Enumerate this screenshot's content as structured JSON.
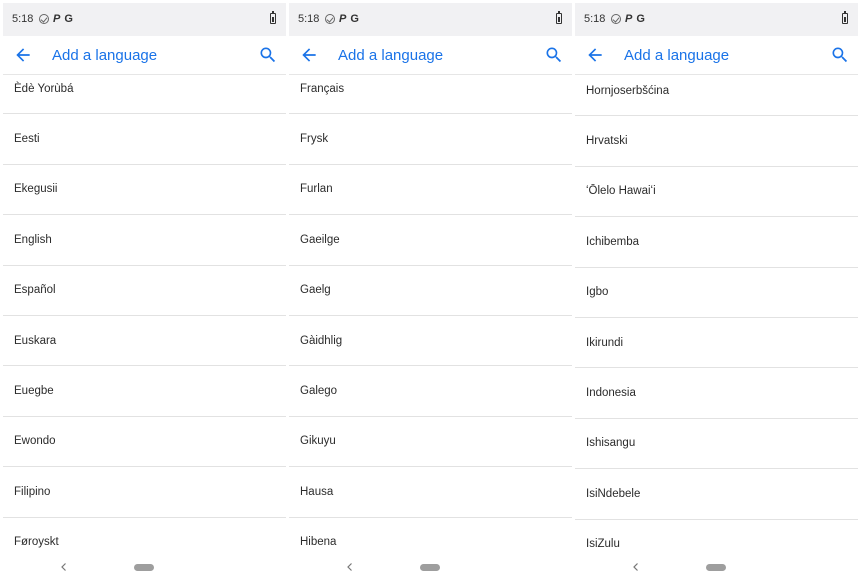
{
  "status_bar": {
    "time": "5:18",
    "p_glyph": "P",
    "g_glyph": "G"
  },
  "app_bar": {
    "title": "Add a language",
    "back_icon": "arrow-back-icon",
    "search_icon": "search-icon"
  },
  "colors": {
    "accent": "#1a73e8",
    "status_bar_bg": "#f1f1f3",
    "divider": "#e2e2e2"
  },
  "panels": [
    {
      "items": [
        "Èdè Yorùbá",
        "Eesti",
        "Ekegusii",
        "English",
        "Español",
        "Euskara",
        "Euegbe",
        "Ewondo",
        "Filipino",
        "Føroyskt"
      ]
    },
    {
      "items": [
        "Français",
        "Frysk",
        "Furlan",
        "Gaeilge",
        "Gaelg",
        "Gàidhlig",
        "Galego",
        "Gikuyu",
        "Hausa",
        "Hibena"
      ]
    },
    {
      "items": [
        "Hornjoserbšćina",
        "Hrvatski",
        "ʻŌlelo Hawaiʻi",
        "Ichibemba",
        "Igbo",
        "Ikirundi",
        "Indonesia",
        "Ishisangu",
        "IsiNdebele",
        "IsiZulu"
      ]
    }
  ]
}
